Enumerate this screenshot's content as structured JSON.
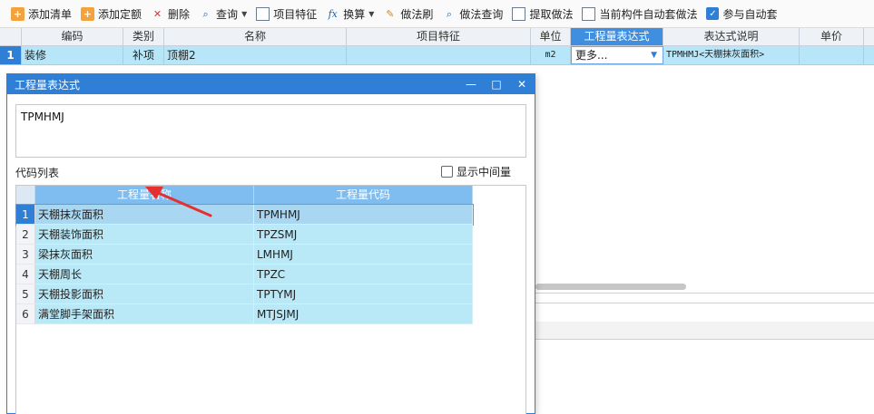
{
  "toolbar": {
    "items": [
      {
        "label": "添加清单",
        "icon": "add-list-icon"
      },
      {
        "label": "添加定额",
        "icon": "add-quota-icon"
      },
      {
        "label": "删除",
        "icon": "delete-icon"
      },
      {
        "label": "查询",
        "icon": "search-icon"
      },
      {
        "label": "项目特征",
        "icon": "project-feature-icon"
      },
      {
        "label": "换算",
        "icon": "fx-icon"
      },
      {
        "label": "做法刷",
        "icon": "brush-icon"
      },
      {
        "label": "做法查询",
        "icon": "method-query-icon"
      },
      {
        "label": "提取做法",
        "icon": "extract-icon"
      },
      {
        "label": "当前构件自动套做法",
        "icon": "auto-apply-icon"
      },
      {
        "label": "参与自动套",
        "icon": "checkbox-checked-icon"
      }
    ]
  },
  "grid": {
    "columns": [
      "编码",
      "类别",
      "名称",
      "项目特征",
      "单位",
      "工程量表达式",
      "表达式说明",
      "单价"
    ],
    "row": {
      "index": "1",
      "code": "装修",
      "category": "补项",
      "name": "顶棚2",
      "feature": "",
      "unit": "m2",
      "expression": "更多...",
      "description": "TPMHMJ<天棚抹灰面积>",
      "price": ""
    }
  },
  "dialog": {
    "title": "工程量表达式",
    "expression_value": "TPMHMJ",
    "code_list_label": "代码列表",
    "show_intermediate_label": "显示中间量",
    "table": {
      "headers": [
        "工程量名称",
        "工程量代码"
      ],
      "rows": [
        {
          "index": "1",
          "name": "天棚抹灰面积",
          "code": "TPMHMJ"
        },
        {
          "index": "2",
          "name": "天棚装饰面积",
          "code": "TPZSMJ"
        },
        {
          "index": "3",
          "name": "梁抹灰面积",
          "code": "LMHMJ"
        },
        {
          "index": "4",
          "name": "天棚周长",
          "code": "TPZC"
        },
        {
          "index": "5",
          "name": "天棚投影面积",
          "code": "TPTYMJ"
        },
        {
          "index": "6",
          "name": "满堂脚手架面积",
          "code": "MTJSJMJ"
        }
      ]
    }
  },
  "colors": {
    "accent": "#2f7fd6",
    "row_highlight": "#b7e6f8",
    "arrow": "#e53030"
  }
}
